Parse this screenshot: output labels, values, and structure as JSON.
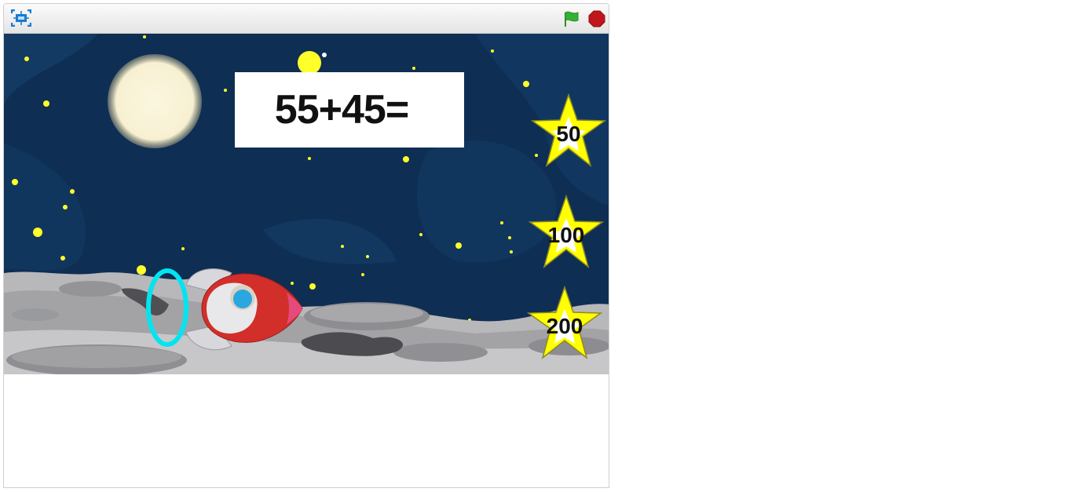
{
  "controls": {
    "fullscreen_icon": "fullscreen-icon",
    "flag_icon": "green-flag-icon",
    "stop_icon": "stop-sign-icon",
    "flag_color": "#33b233",
    "stop_color": "#c0171c"
  },
  "stage": {
    "sky_color": "#0f2e54",
    "question": "55+45=",
    "answers": [
      {
        "label": "50"
      },
      {
        "label": "100"
      },
      {
        "label": "200"
      }
    ],
    "star_color": "#ffff00",
    "ring_color": "#00e5f0"
  }
}
